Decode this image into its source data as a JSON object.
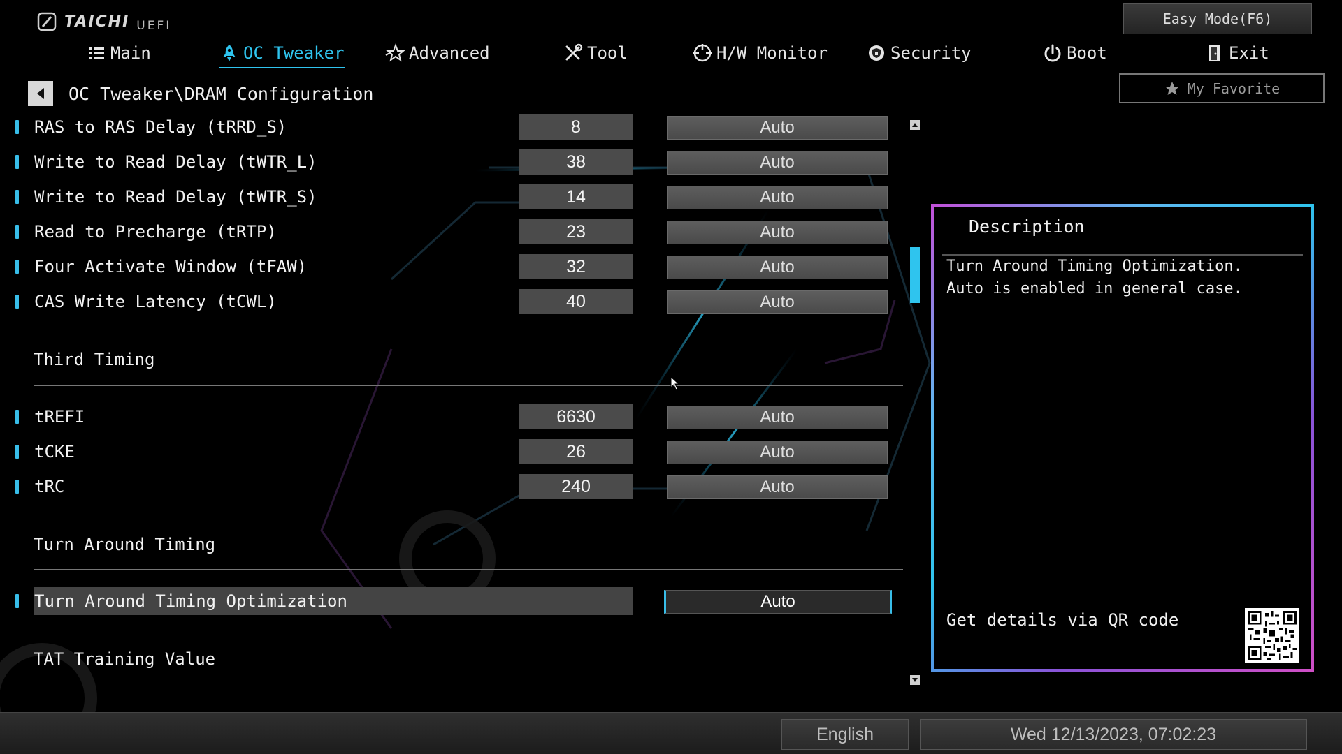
{
  "logo": {
    "brand": "TAICHI",
    "sub": "UEFI"
  },
  "nav": {
    "items": [
      {
        "label": "Main",
        "icon": "list-icon"
      },
      {
        "label": "OC Tweaker",
        "icon": "rocket-icon",
        "active": true
      },
      {
        "label": "Advanced",
        "icon": "star-icon"
      },
      {
        "label": "Tool",
        "icon": "tools-icon"
      },
      {
        "label": "H/W Monitor",
        "icon": "monitor-icon"
      },
      {
        "label": "Security",
        "icon": "shield-icon"
      },
      {
        "label": "Boot",
        "icon": "power-icon"
      },
      {
        "label": "Exit",
        "icon": "exit-icon"
      }
    ],
    "easy_mode": "Easy Mode(F6)",
    "favorite": "My Favorite"
  },
  "breadcrumb": "OC Tweaker\\DRAM Configuration",
  "settings": {
    "group1": [
      {
        "label": "RAS to RAS Delay (tRRD_S)",
        "value": "8",
        "option": "Auto"
      },
      {
        "label": "Write to Read Delay (tWTR_L)",
        "value": "38",
        "option": "Auto"
      },
      {
        "label": "Write to Read Delay (tWTR_S)",
        "value": "14",
        "option": "Auto"
      },
      {
        "label": "Read to Precharge (tRTP)",
        "value": "23",
        "option": "Auto"
      },
      {
        "label": "Four Activate Window (tFAW)",
        "value": "32",
        "option": "Auto"
      },
      {
        "label": "CAS Write Latency (tCWL)",
        "value": "40",
        "option": "Auto"
      }
    ],
    "section_third": "Third Timing",
    "group2": [
      {
        "label": "tREFI",
        "value": "6630",
        "option": "Auto"
      },
      {
        "label": "tCKE",
        "value": "26",
        "option": "Auto"
      },
      {
        "label": "tRC",
        "value": "240",
        "option": "Auto"
      }
    ],
    "section_turn": "Turn Around Timing",
    "selected": {
      "label": "Turn Around Timing Optimization",
      "option": "Auto"
    },
    "section_tat": "TAT Training Value"
  },
  "description": {
    "title": "Description",
    "line1": "Turn Around Timing Optimization.",
    "line2": "Auto is enabled in general case.",
    "qr_text": "Get details via QR code"
  },
  "footer": {
    "language": "English",
    "datetime": "Wed 12/13/2023, 07:02:23"
  },
  "colors": {
    "accent": "#2fc4ee",
    "marker": "#38bde8"
  }
}
